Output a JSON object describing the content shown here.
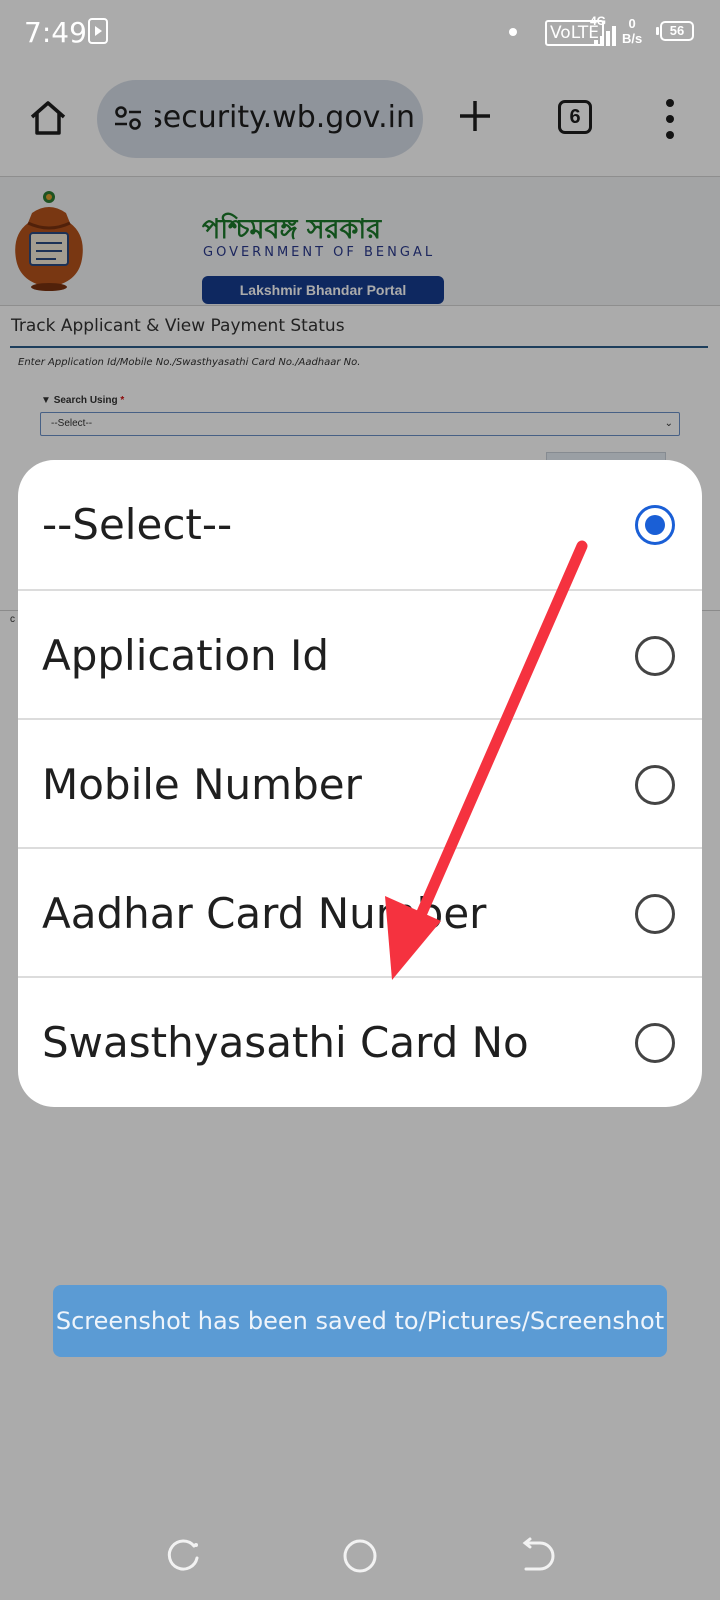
{
  "status_bar": {
    "time": "7:49",
    "network_type": "VoLTE",
    "network_gen": "4G",
    "speed_value": "0",
    "speed_unit": "B/s",
    "battery": "56"
  },
  "browser": {
    "url": "security.wb.gov.in",
    "tab_count": "6",
    "icons": [
      "home-icon",
      "site-settings-icon",
      "new-tab-icon",
      "tab-switcher-icon",
      "more-menu-icon"
    ]
  },
  "page": {
    "bengali_title": "পশ্চিমবঙ্গ সরকার",
    "gov_title": "GOVERNMENT OF BENGAL",
    "portal_name": "Lakshmir Bhandar Portal",
    "heading": "Track Applicant & View Payment Status",
    "instruction": "Enter Application Id/Mobile No./Swasthyasathi Card No./Aadhaar No.",
    "search_label": "Search Using",
    "required_mark": "*",
    "select_value": "--Select--",
    "faint_text": "c"
  },
  "dialog": {
    "options": [
      {
        "label": "--Select--",
        "selected": true
      },
      {
        "label": "Application Id",
        "selected": false
      },
      {
        "label": "Mobile Number",
        "selected": false
      },
      {
        "label": "Aadhar Card Number",
        "selected": false
      },
      {
        "label": "Swasthyasathi Card No",
        "selected": false
      }
    ]
  },
  "toast": {
    "message": "Screenshot has been saved to/Pictures/Screenshot"
  },
  "colors": {
    "accent_radio": "#1a5fd6",
    "annotation_arrow": "#f5323f",
    "toast_bg": "#5b9bd4",
    "portal_badge": "#163c8f",
    "bengali_title": "#1b7a2a"
  }
}
